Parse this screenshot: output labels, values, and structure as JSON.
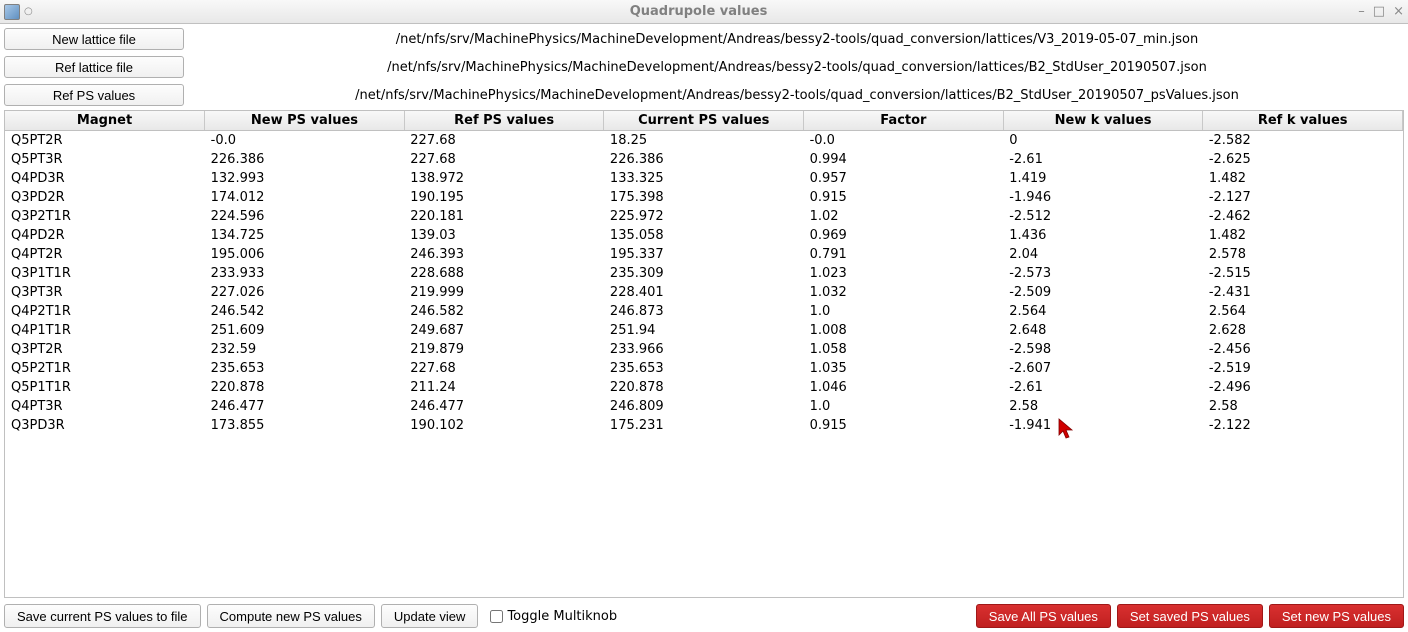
{
  "window": {
    "title": "Quadrupole values"
  },
  "files": {
    "new_lattice_btn": "New lattice file",
    "new_lattice_path": "/net/nfs/srv/MachinePhysics/MachineDevelopment/Andreas/bessy2-tools/quad_conversion/lattices/V3_2019-05-07_min.json",
    "ref_lattice_btn": "Ref lattice file",
    "ref_lattice_path": "/net/nfs/srv/MachinePhysics/MachineDevelopment/Andreas/bessy2-tools/quad_conversion/lattices/B2_StdUser_20190507.json",
    "ref_ps_btn": "Ref PS values",
    "ref_ps_path": "/net/nfs/srv/MachinePhysics/MachineDevelopment/Andreas/bessy2-tools/quad_conversion/lattices/B2_StdUser_20190507_psValues.json"
  },
  "table": {
    "columns": [
      "Magnet",
      "New PS values",
      "Ref PS values",
      "Current PS values",
      "Factor",
      "New k values",
      "Ref k values"
    ],
    "rows": [
      [
        "Q5PT2R",
        "-0.0",
        "227.68",
        "18.25",
        "-0.0",
        "0",
        "-2.582"
      ],
      [
        "Q5PT3R",
        "226.386",
        "227.68",
        "226.386",
        "0.994",
        "-2.61",
        "-2.625"
      ],
      [
        "Q4PD3R",
        "132.993",
        "138.972",
        "133.325",
        "0.957",
        "1.419",
        "1.482"
      ],
      [
        "Q3PD2R",
        "174.012",
        "190.195",
        "175.398",
        "0.915",
        "-1.946",
        "-2.127"
      ],
      [
        "Q3P2T1R",
        "224.596",
        "220.181",
        "225.972",
        "1.02",
        "-2.512",
        "-2.462"
      ],
      [
        "Q4PD2R",
        "134.725",
        "139.03",
        "135.058",
        "0.969",
        "1.436",
        "1.482"
      ],
      [
        "Q4PT2R",
        "195.006",
        "246.393",
        "195.337",
        "0.791",
        "2.04",
        "2.578"
      ],
      [
        "Q3P1T1R",
        "233.933",
        "228.688",
        "235.309",
        "1.023",
        "-2.573",
        "-2.515"
      ],
      [
        "Q3PT3R",
        "227.026",
        "219.999",
        "228.401",
        "1.032",
        "-2.509",
        "-2.431"
      ],
      [
        "Q4P2T1R",
        "246.542",
        "246.582",
        "246.873",
        "1.0",
        "2.564",
        "2.564"
      ],
      [
        "Q4P1T1R",
        "251.609",
        "249.687",
        "251.94",
        "1.008",
        "2.648",
        "2.628"
      ],
      [
        "Q3PT2R",
        "232.59",
        "219.879",
        "233.966",
        "1.058",
        "-2.598",
        "-2.456"
      ],
      [
        "Q5P2T1R",
        "235.653",
        "227.68",
        "235.653",
        "1.035",
        "-2.607",
        "-2.519"
      ],
      [
        "Q5P1T1R",
        "220.878",
        "211.24",
        "220.878",
        "1.046",
        "-2.61",
        "-2.496"
      ],
      [
        "Q4PT3R",
        "246.477",
        "246.477",
        "246.809",
        "1.0",
        "2.58",
        "2.58"
      ],
      [
        "Q3PD3R",
        "173.855",
        "190.102",
        "175.231",
        "0.915",
        "-1.941",
        "-2.122"
      ]
    ]
  },
  "bottom": {
    "save_current": "Save current PS values to file",
    "compute": "Compute new PS values",
    "update": "Update view",
    "toggle": "Toggle Multiknob",
    "save_all": "Save All PS values",
    "set_saved": "Set saved PS values",
    "set_new": "Set new PS values"
  }
}
